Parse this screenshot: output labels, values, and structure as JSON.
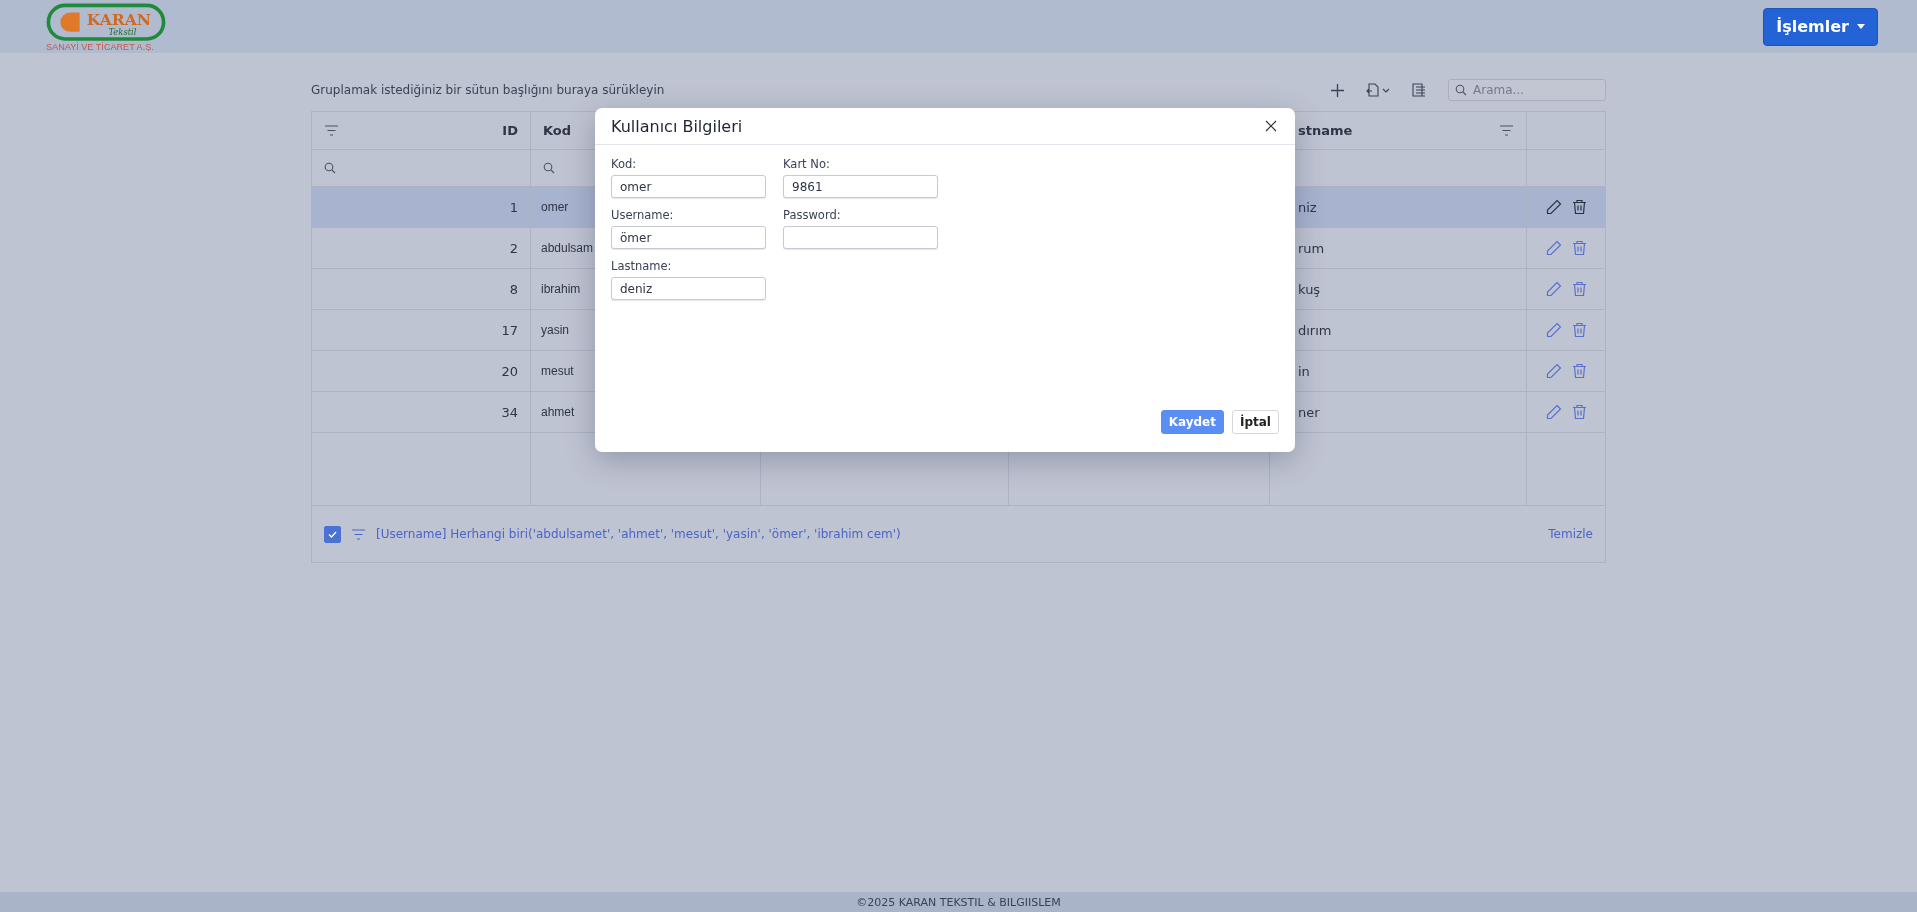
{
  "header": {
    "logo": {
      "name": "KARAN",
      "subtitle": "Tekstil",
      "tagline": "SANAYİ VE TİCARET A.Ş."
    },
    "menu_button": "İşlemler"
  },
  "toolbar": {
    "group_hint": "Gruplamak istediğiniz bir sütun başlığını buraya sürükleyin",
    "search": {
      "placeholder": "Arama..."
    }
  },
  "table": {
    "columns": [
      {
        "label": "ID"
      },
      {
        "label": "Kod"
      },
      {},
      {},
      {
        "label": "stname"
      },
      {}
    ],
    "rows": [
      {
        "id": "1",
        "kod": "omer",
        "column_5": "niz",
        "selected": true
      },
      {
        "id": "2",
        "kod": "abdulsam",
        "column_5": "rum",
        "selected": false
      },
      {
        "id": "8",
        "kod": "ibrahim",
        "column_5": "kuş",
        "selected": false
      },
      {
        "id": "17",
        "kod": "yasin",
        "column_5": "dırım",
        "selected": false
      },
      {
        "id": "20",
        "kod": "mesut",
        "column_5": "in",
        "selected": false
      },
      {
        "id": "34",
        "kod": "ahmet",
        "column_5": "ner",
        "selected": false
      }
    ],
    "filter_panel": {
      "enabled": true,
      "text": "[Username] Herhangi biri('abdulsamet', 'ahmet', 'mesut', 'yasin', 'ömer', 'ibrahim cem')",
      "clear": "Temizle"
    }
  },
  "dialog": {
    "title": "Kullanıcı Bilgileri",
    "fields": [
      {
        "label": "Kod:",
        "value": "omer"
      },
      {
        "label": "Kart No:",
        "value": "9861"
      },
      {
        "label": "Username:",
        "value": "ömer"
      },
      {
        "label": "Password:"
      },
      {
        "label": "Lastname:",
        "value": "deniz"
      }
    ],
    "buttons": [
      {
        "label": "Kaydet",
        "kind": "primary"
      },
      {
        "label": "İptal",
        "kind": "secondary"
      }
    ]
  },
  "footer": "©2025 KARAN TEKSTIL & BILGIISLEM"
}
